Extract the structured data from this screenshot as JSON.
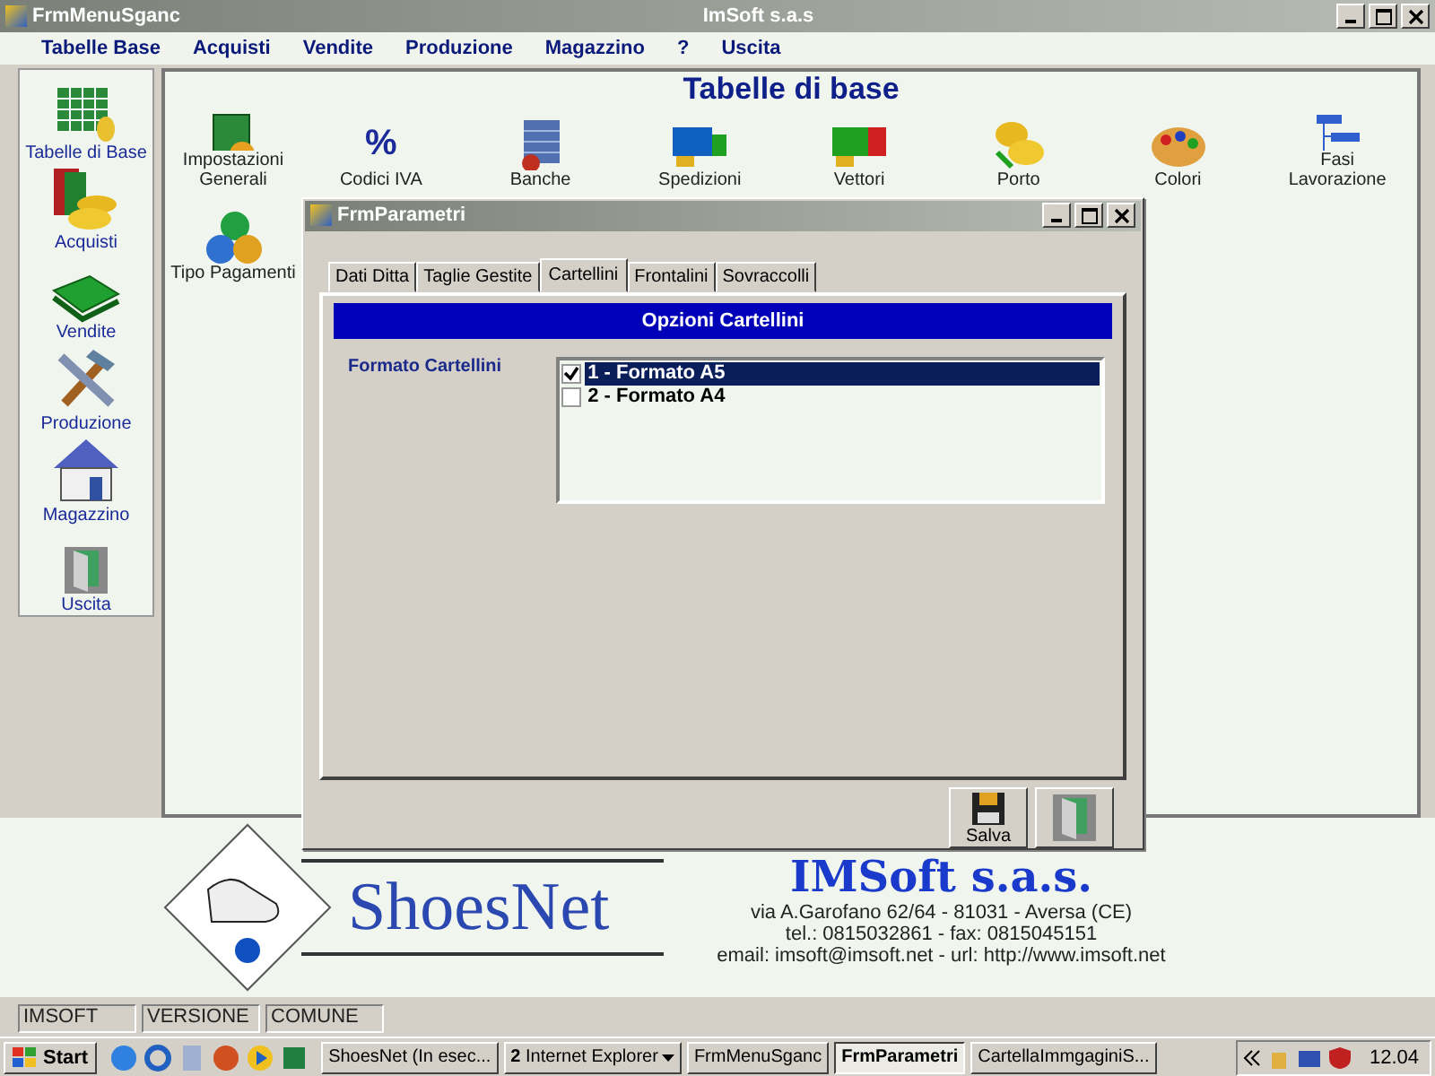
{
  "main_window": {
    "title_left": "FrmMenuSganc",
    "title": "ImSoft s.a.s"
  },
  "menu": [
    "Tabelle Base",
    "Acquisti",
    "Vendite",
    "Produzione",
    "Magazzino",
    "?",
    "Uscita"
  ],
  "sidebar": [
    {
      "label": "Tabelle di Base",
      "kind": "table"
    },
    {
      "label": "Acquisti",
      "kind": "coins"
    },
    {
      "label": "Vendite",
      "kind": "cash"
    },
    {
      "label": "Produzione",
      "kind": "tools"
    },
    {
      "label": "Magazzino",
      "kind": "house"
    },
    {
      "label": "Uscita",
      "kind": "door"
    }
  ],
  "section_title": "Tabelle di base",
  "tiles": [
    {
      "label": "Impostazioni Generali",
      "kind": "book"
    },
    {
      "label": "Codici IVA",
      "kind": "percent",
      "glyph": "%"
    },
    {
      "label": "Banche",
      "kind": "bank"
    },
    {
      "label": "Spedizioni",
      "kind": "truck"
    },
    {
      "label": "Vettori",
      "kind": "lorry"
    },
    {
      "label": "Porto",
      "kind": "coins"
    },
    {
      "label": "Colori",
      "kind": "palette"
    },
    {
      "label": "Fasi Lavorazione",
      "kind": "tree"
    },
    {
      "label": "Tipo Pagamenti",
      "kind": "money"
    }
  ],
  "dialog": {
    "title": "FrmParametri",
    "tabs": [
      {
        "label": "Dati Ditta",
        "selected": false
      },
      {
        "label": "Taglie Gestite",
        "selected": false
      },
      {
        "label": "Cartellini",
        "selected": true
      },
      {
        "label": "Frontalini",
        "selected": false
      },
      {
        "label": "Sovraccolli",
        "selected": false
      }
    ],
    "header": "Opzioni Cartellini",
    "field_label": "Formato Cartellini",
    "options": [
      {
        "label": "1 - Formato A5",
        "checked": true,
        "selected": true
      },
      {
        "label": "2 - Formato A4",
        "checked": false,
        "selected": false
      }
    ],
    "buttons": [
      {
        "kind": "save",
        "label": "Salva"
      },
      {
        "kind": "exit"
      }
    ]
  },
  "logo": {
    "product": "ShoesNet",
    "company": "IMSoft s.a.s.",
    "address": "via A.Garofano 62/64 - 81031 - Aversa (CE)",
    "phone": "tel.: 0815032861 - fax: 0815045151",
    "contact": "email: imsoft@imsoft.net - url: http://www.imsoft.net"
  },
  "status_bar": [
    "IMSOFT",
    "VERSIONE",
    "COMUNE"
  ],
  "taskbar": {
    "start": "Start",
    "tasks": [
      {
        "label": "ShoesNet (In esec...",
        "selected": false
      },
      {
        "label": "**2** Internet Explorer",
        "selected": false,
        "dropdown": true
      },
      {
        "label": "FrmMenuSganc",
        "selected": false
      },
      {
        "label": "FrmParametri",
        "selected": true
      },
      {
        "label": "CartellaImmgaginiS...",
        "selected": false
      }
    ],
    "clock": "12.04"
  }
}
